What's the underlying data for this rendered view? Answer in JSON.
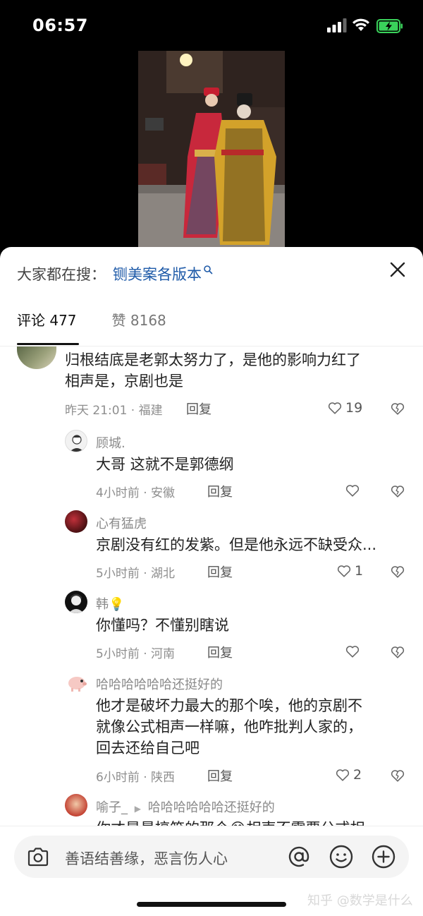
{
  "status_bar": {
    "time": "06:57"
  },
  "search_bar": {
    "prefix": "大家都在搜：",
    "term": "铡美案各版本"
  },
  "tabs": {
    "comments": "评论 477",
    "likes": "赞 8168"
  },
  "comments": [
    {
      "text_line1": "归根结底是老郭太努力了，是他的影响力红了",
      "text_line2": "相声是，京剧也是",
      "meta": "昨天 21:01 · 福建",
      "reply": "回复",
      "likes": "19"
    }
  ],
  "replies": [
    {
      "user": "顾城.",
      "text": "大哥 这就不是郭德纲",
      "meta": "4小时前 · 安徽",
      "reply": "回复",
      "likes": ""
    },
    {
      "user": "心有猛虎",
      "text": "京剧没有红的发紫。但是他永远不缺受众...",
      "meta": "5小时前 · 湖北",
      "reply": "回复",
      "likes": "1"
    },
    {
      "user": "韩💡",
      "text": "你懂吗？不懂别瞎说",
      "meta": "5小时前 · 河南",
      "reply": "回复",
      "likes": ""
    },
    {
      "user": "哈哈哈哈哈哈还挺好的",
      "text_line1": "他才是破坏力最大的那个唉，他的京剧不",
      "text_line2": "就像公式相声一样嘛，他咋批判人家的，",
      "text_line3": "回去还给自己吧",
      "meta": "6小时前 · 陕西",
      "reply": "回复",
      "likes": "2"
    },
    {
      "user": "喻子_",
      "reply_to": "哈哈哈哈哈哈还挺好的",
      "text": "你才是最搞笑的那个😂相声不需要公式相"
    }
  ],
  "composer": {
    "placeholder": "善语结善缘，恶言伤人心"
  },
  "watermark": "知乎 @数学是什么",
  "colors": {
    "link_blue": "#1e5aa8",
    "meta_gray": "#8e8e8e",
    "sheet_bg": "#ffffff"
  }
}
